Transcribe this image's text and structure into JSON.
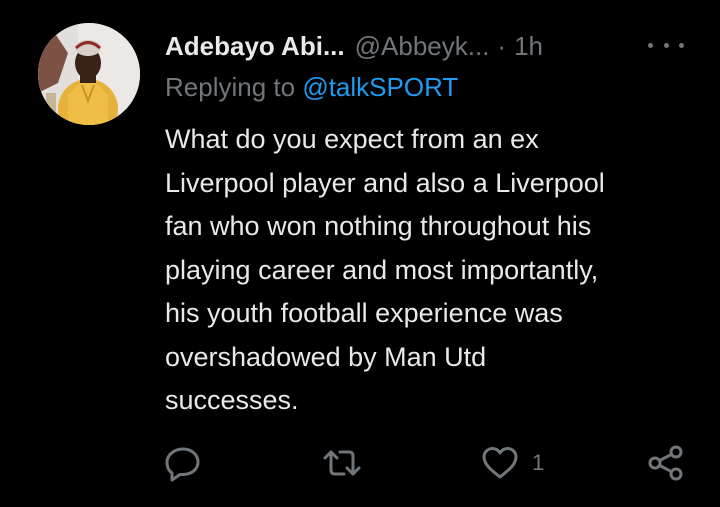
{
  "tweet": {
    "author_name": "Adebayo Abi...",
    "author_handle": "@Abbeyk...",
    "separator": "·",
    "time": "1h",
    "reply_prefix": "Replying to",
    "reply_mention": "@talkSPORT",
    "text_lines": [
      "What do you expect from an ex",
      "Liverpool player and also a Liverpool",
      "fan who won nothing throughout his",
      "playing career and most importantly,",
      "his youth football experience was",
      "overshadowed by Man Utd",
      "successes."
    ],
    "like_count": "1"
  },
  "icons": {
    "more": "more-dots-icon",
    "reply": "reply-bubble-icon",
    "retweet": "retweet-icon",
    "like": "heart-icon",
    "share": "share-icon"
  },
  "colors": {
    "background": "#000000",
    "primary_text": "#e7e9ea",
    "secondary_text": "#71767b",
    "link": "#1d9bf0"
  }
}
